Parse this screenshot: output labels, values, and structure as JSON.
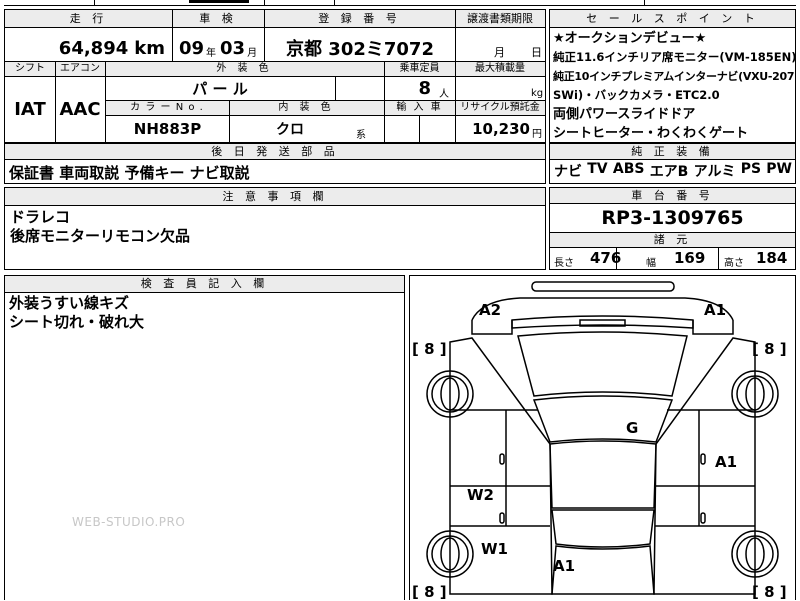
{
  "header_row": {
    "mileage_label": "走 行",
    "inspection_label": "車 検",
    "registration_label": "登 録 番 号",
    "transfer_label": "譲渡書類期限",
    "sales_points_label": "セ ー ル ス ポ イ ン ト"
  },
  "vehicle": {
    "mileage_value": "64,894",
    "mileage_unit": "km",
    "inspection_year": "09",
    "year_suffix": "年",
    "inspection_month": "03",
    "month_suffix": "月",
    "registration_plate": "京都 302ミ7072",
    "transfer_month_suffix": "月",
    "transfer_day_suffix": "日",
    "shift_label": "シフト",
    "aircon_label": "エアコン",
    "exterior_label": "外 装 色",
    "capacity_label": "乗車定員",
    "max_load_label": "最大積載量",
    "shift_value": "IAT",
    "aircon_value": "AAC",
    "exterior_value": "パ ー ル",
    "capacity_value": "8",
    "capacity_unit": "人",
    "load_unit": "kg",
    "color_no_label": "カ ラ ー  N o .",
    "interior_label": "内 装 色",
    "import_label": "輸 入 車",
    "recycle_label": "リサイクル預託金",
    "color_no_value": "NH883P",
    "interior_value": "クロ",
    "interior_suffix": "系",
    "recycle_value": "10,230",
    "recycle_unit": "円"
  },
  "sales_points": [
    "★オークションデビュー★",
    "純正11.6インチリア席モニター(VM-185EN)",
    "純正10インチプレミアムインターナビ(VXU-207",
    "SWi)・バックカメラ・ETC2.0",
    "両側パワースライドドア",
    "シートヒーター・わくわくゲート"
  ],
  "aftermarket": {
    "label": "後 日 発 送 部 品",
    "value": "保証書 車両取説 予備キー ナビ取説"
  },
  "equipment": {
    "label": "純 正 装 備",
    "items": [
      "ナビ",
      "TV",
      "ABS",
      "エアB",
      "アルミ",
      "PS",
      "PW"
    ]
  },
  "notes": {
    "label": "注 意 事 項 欄",
    "lines": [
      "ドラレコ",
      "後席モニターリモコン欠品"
    ]
  },
  "chassis": {
    "label": "車 台 番 号",
    "value": "RP3-1309765"
  },
  "dimensions": {
    "label": "諸 元",
    "length_label": "長さ",
    "length_value": "476",
    "width_label": "幅",
    "width_value": "169",
    "height_label": "高さ",
    "height_value": "184"
  },
  "inspector": {
    "label": "検 査 員 記 入 欄",
    "lines": [
      "外装うすい線キズ",
      "シート切れ・破れ大"
    ]
  },
  "diagram": {
    "marks": {
      "front_left": "A2",
      "front_right": "A1",
      "hood": "G",
      "right_front_door": "A1",
      "left_rear_door": "W2",
      "left_rear_quarter": "W1",
      "rear": "A1"
    },
    "tire_readings": {
      "front_left": "8",
      "front_right": "8",
      "rear_left": "8",
      "rear_right": "8"
    }
  },
  "watermark": "WEB-STUDIO.PRO"
}
